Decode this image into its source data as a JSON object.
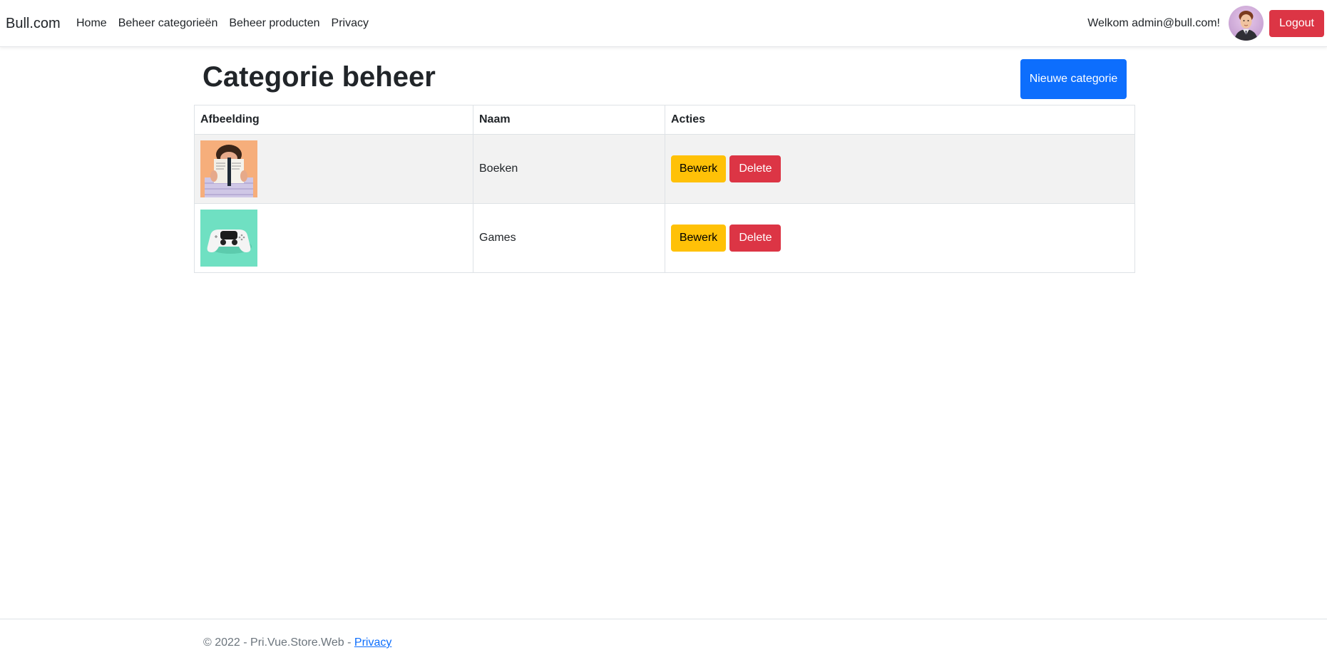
{
  "navbar": {
    "brand": "Bull.com",
    "links": [
      {
        "label": "Home"
      },
      {
        "label": "Beheer categorieën"
      },
      {
        "label": "Beheer producten"
      },
      {
        "label": "Privacy"
      }
    ],
    "welcome_text": "Welkom admin@bull.com!",
    "logout_label": "Logout"
  },
  "main": {
    "title": "Categorie beheer",
    "new_button_label": "Nieuwe categorie",
    "table": {
      "headers": [
        "Afbeelding",
        "Naam",
        "Acties"
      ],
      "rows": [
        {
          "name": "Boeken",
          "image_icon": "book-reader-image",
          "edit_label": "Bewerk",
          "delete_label": "Delete"
        },
        {
          "name": "Games",
          "image_icon": "game-controller-image",
          "edit_label": "Bewerk",
          "delete_label": "Delete"
        }
      ]
    }
  },
  "footer": {
    "text": "© 2022 - Pri.Vue.Store.Web - ",
    "link_label": "Privacy"
  },
  "colors": {
    "primary": "#0d6efd",
    "danger": "#dc3545",
    "warning": "#ffc107",
    "stripe": "#f2f2f2"
  }
}
